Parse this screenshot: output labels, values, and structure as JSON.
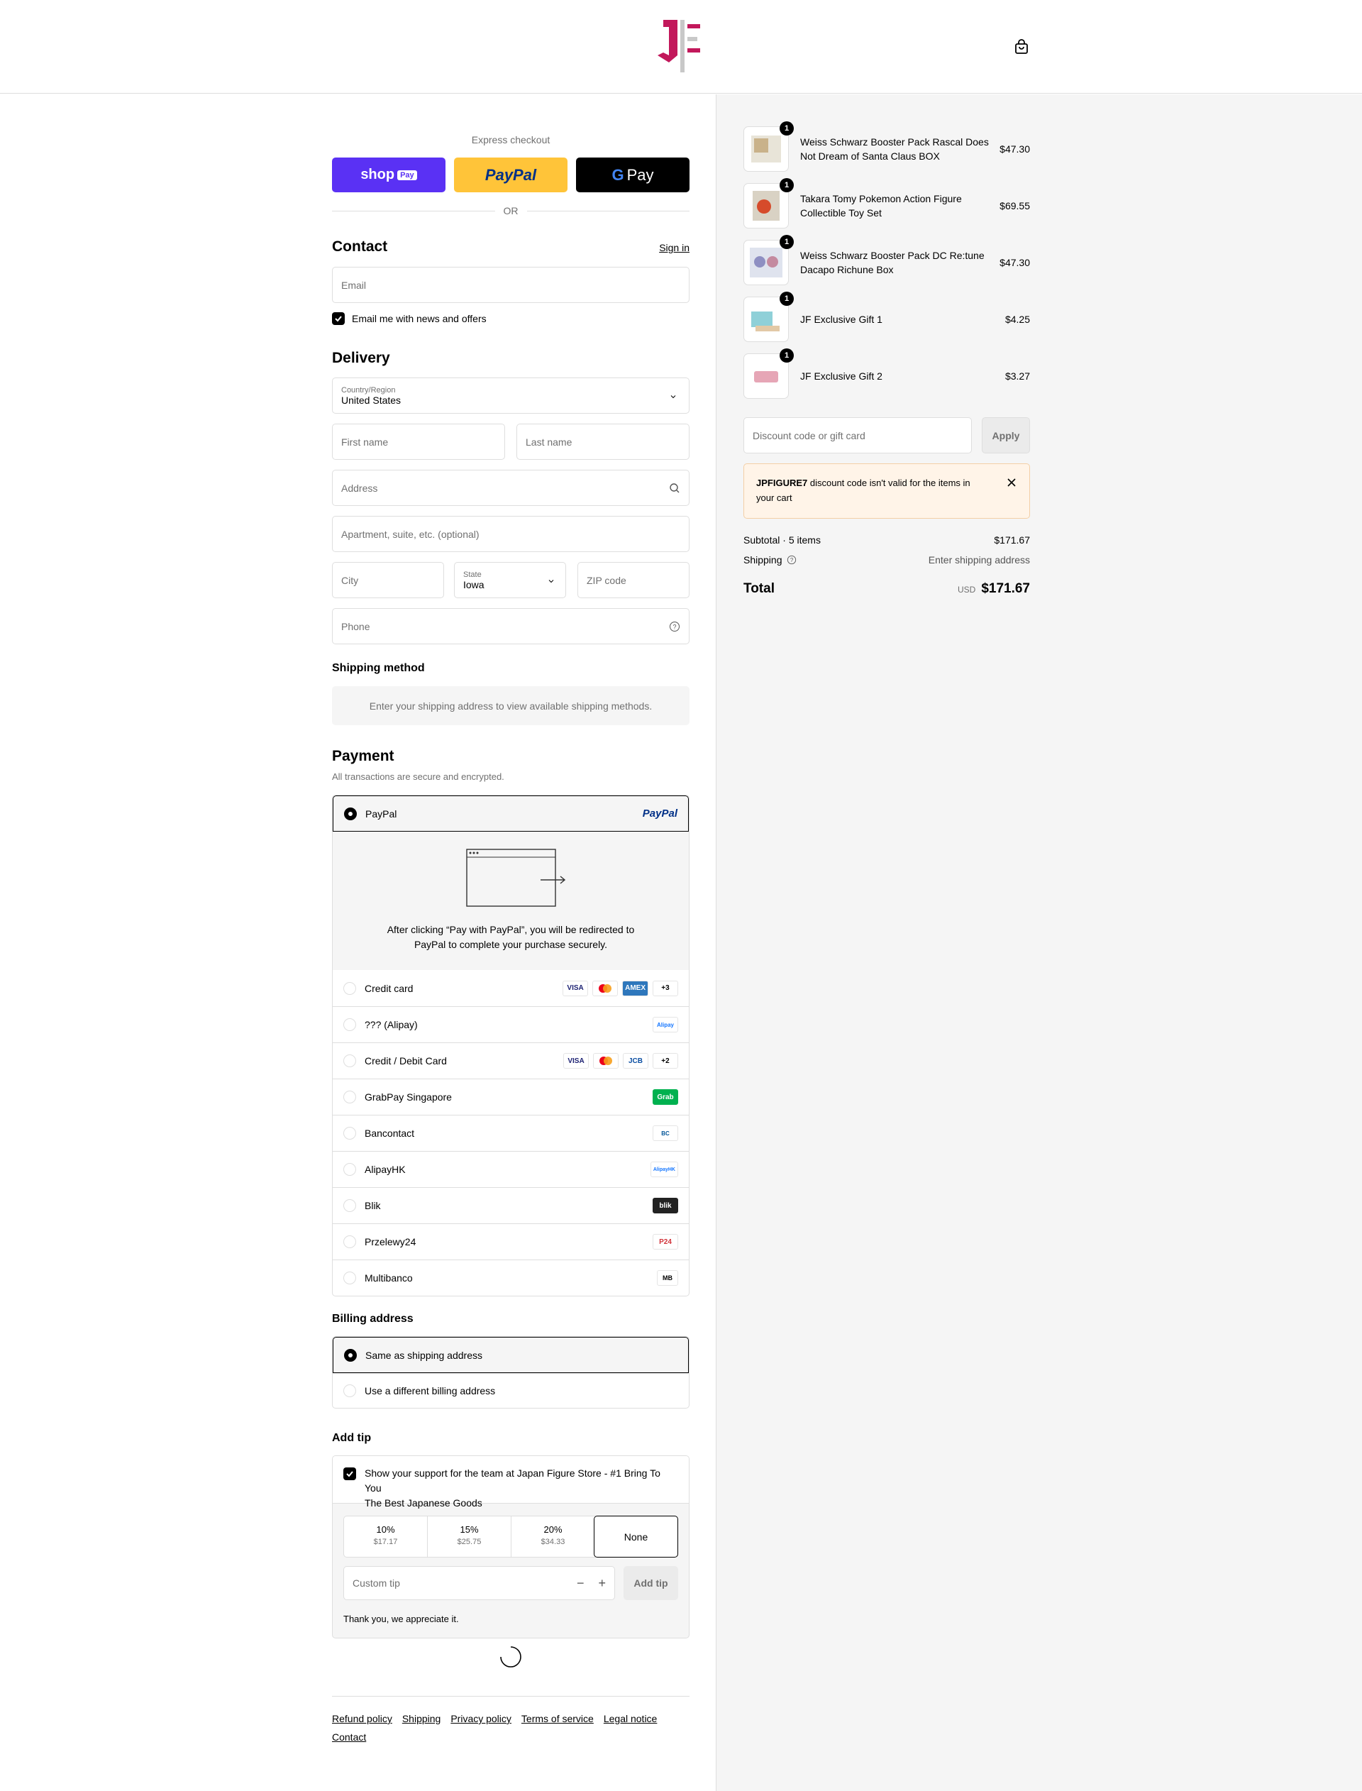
{
  "header": {
    "logo_text": "JF"
  },
  "express": {
    "label": "Express checkout",
    "shop_label": "shop",
    "shop_pay": "Pay",
    "paypal_label": "PayPal",
    "gpay_label": "Pay",
    "or": "OR"
  },
  "contact": {
    "title": "Contact",
    "sign_in": "Sign in",
    "email_placeholder": "Email",
    "news_label": "Email me with news and offers"
  },
  "delivery": {
    "title": "Delivery",
    "country_label": "Country/Region",
    "country_value": "United States",
    "first_name": "First name",
    "last_name": "Last name",
    "address": "Address",
    "apartment": "Apartment, suite, etc. (optional)",
    "city": "City",
    "state_label": "State",
    "state_value": "Iowa",
    "zip": "ZIP code",
    "phone": "Phone"
  },
  "shipping_method": {
    "title": "Shipping method",
    "notice": "Enter your shipping address to view available shipping methods."
  },
  "payment": {
    "title": "Payment",
    "subtitle": "All transactions are secure and encrypted.",
    "selected": "PayPal",
    "selected_logo": "PayPal",
    "redirect_text_1": "After clicking “Pay with PayPal”, you will be redirected to",
    "redirect_text_2": "PayPal to complete your purchase securely.",
    "methods": [
      {
        "label": "Credit card",
        "logos": [
          "VISA",
          "MC",
          "AMEX",
          "+3"
        ]
      },
      {
        "label": "??? (Alipay)",
        "logos": [
          "Alipay"
        ]
      },
      {
        "label": "Credit / Debit Card",
        "logos": [
          "VISA",
          "MC",
          "JCB",
          "+2"
        ]
      },
      {
        "label": "GrabPay Singapore",
        "logos": [
          "Grab"
        ]
      },
      {
        "label": "Bancontact",
        "logos": [
          "BC"
        ]
      },
      {
        "label": "AlipayHK",
        "logos": [
          "AlipayHK"
        ]
      },
      {
        "label": "Blik",
        "logos": [
          "blik"
        ]
      },
      {
        "label": "Przelewy24",
        "logos": [
          "P24"
        ]
      },
      {
        "label": "Multibanco",
        "logos": [
          "MB"
        ]
      }
    ]
  },
  "billing": {
    "title": "Billing address",
    "same": "Same as shipping address",
    "different": "Use a different billing address"
  },
  "tip": {
    "title": "Add tip",
    "support_text_1": "Show your support for the team at Japan Figure Store - #1 Bring To You",
    "support_text_2": "The Best Japanese Goods",
    "options": [
      {
        "pct": "10%",
        "amt": "$17.17"
      },
      {
        "pct": "15%",
        "amt": "$25.75"
      },
      {
        "pct": "20%",
        "amt": "$34.33"
      },
      {
        "pct": "None",
        "amt": ""
      }
    ],
    "custom_placeholder": "Custom tip",
    "add_button": "Add tip",
    "thanks": "Thank you, we appreciate it."
  },
  "footer": {
    "links": [
      "Refund policy",
      "Shipping",
      "Privacy policy",
      "Terms of service",
      "Legal notice",
      "Contact"
    ]
  },
  "summary": {
    "items": [
      {
        "qty": "1",
        "name": "Weiss Schwarz Booster Pack Rascal Does Not Dream of Santa Claus BOX",
        "price": "$47.30"
      },
      {
        "qty": "1",
        "name": "Takara Tomy Pokemon Action Figure Collectible Toy Set",
        "price": "$69.55"
      },
      {
        "qty": "1",
        "name": "Weiss Schwarz Booster Pack DC Re:tune Dacapo Richune Box",
        "price": "$47.30"
      },
      {
        "qty": "1",
        "name": "JF Exclusive Gift 1",
        "price": "$4.25"
      },
      {
        "qty": "1",
        "name": "JF Exclusive Gift 2",
        "price": "$3.27"
      }
    ],
    "discount_placeholder": "Discount code or gift card",
    "apply": "Apply",
    "error_code": "JPFIGURE7",
    "error_text_1": "discount code isn't valid for the items in",
    "error_text_2": "your cart",
    "subtotal_label": "Subtotal · 5 items",
    "subtotal_value": "$171.67",
    "shipping_label": "Shipping",
    "shipping_value": "Enter shipping address",
    "total_label": "Total",
    "currency": "USD",
    "total_value": "$171.67"
  }
}
